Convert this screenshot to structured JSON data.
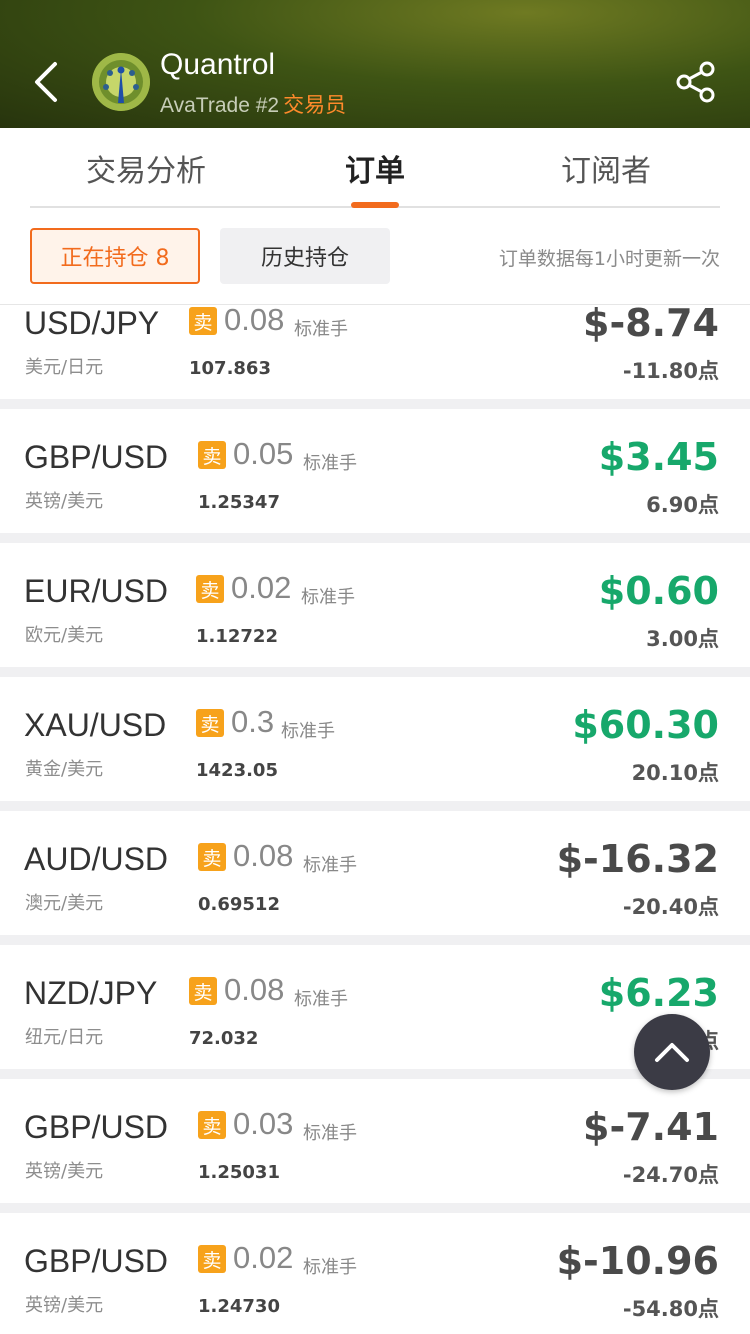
{
  "header": {
    "trader_name": "Quantrol",
    "broker_rank": "AvaTrade #2",
    "role": "交易员",
    "back_icon": "back-arrow-icon",
    "share_icon": "share-icon"
  },
  "tabs": [
    {
      "label": "交易分析",
      "active": false
    },
    {
      "label": "订单",
      "active": true
    },
    {
      "label": "订阅者",
      "active": false
    }
  ],
  "filters": {
    "open_positions": "正在持仓 8",
    "history": "历史持仓",
    "update_note": "订单数据每1小时更新一次"
  },
  "colors": {
    "accent": "#f26b1d",
    "profit": "#17a86b",
    "loss": "#4a4a4a",
    "sell_badge": "#f7a21b"
  },
  "orders": [
    {
      "pair": "USD/JPY",
      "pair_cn": "美元/日元",
      "side": "卖",
      "lots": "0.08",
      "unit": "标准手",
      "price": "107.863",
      "pnl": "$-8.74",
      "pips": "-11.80点",
      "profit": false
    },
    {
      "pair": "GBP/USD",
      "pair_cn": "英镑/美元",
      "side": "卖",
      "lots": "0.05",
      "unit": "标准手",
      "price": "1.25347",
      "pnl": "$3.45",
      "pips": "6.90点",
      "profit": true
    },
    {
      "pair": "EUR/USD",
      "pair_cn": "欧元/美元",
      "side": "卖",
      "lots": "0.02",
      "unit": "标准手",
      "price": "1.12722",
      "pnl": "$0.60",
      "pips": "3.00点",
      "profit": true
    },
    {
      "pair": "XAU/USD",
      "pair_cn": "黄金/美元",
      "side": "卖",
      "lots": "0.3",
      "unit": "标准手",
      "price": "1423.05",
      "pnl": "$60.30",
      "pips": "20.10点",
      "profit": true
    },
    {
      "pair": "AUD/USD",
      "pair_cn": "澳元/美元",
      "side": "卖",
      "lots": "0.08",
      "unit": "标准手",
      "price": "0.69512",
      "pnl": "$-16.32",
      "pips": "-20.40点",
      "profit": false
    },
    {
      "pair": "NZD/JPY",
      "pair_cn": "纽元/日元",
      "side": "卖",
      "lots": "0.08",
      "unit": "标准手",
      "price": "72.032",
      "pnl": "$6.23",
      "pips": "4.40点",
      "profit": true
    },
    {
      "pair": "GBP/USD",
      "pair_cn": "英镑/美元",
      "side": "卖",
      "lots": "0.03",
      "unit": "标准手",
      "price": "1.25031",
      "pnl": "$-7.41",
      "pips": "-24.70点",
      "profit": false
    },
    {
      "pair": "GBP/USD",
      "pair_cn": "英镑/美元",
      "side": "卖",
      "lots": "0.02",
      "unit": "标准手",
      "price": "1.24730",
      "pnl": "$-10.96",
      "pips": "-54.80点",
      "profit": false
    }
  ],
  "scroll_top_icon": "chevron-up-icon"
}
